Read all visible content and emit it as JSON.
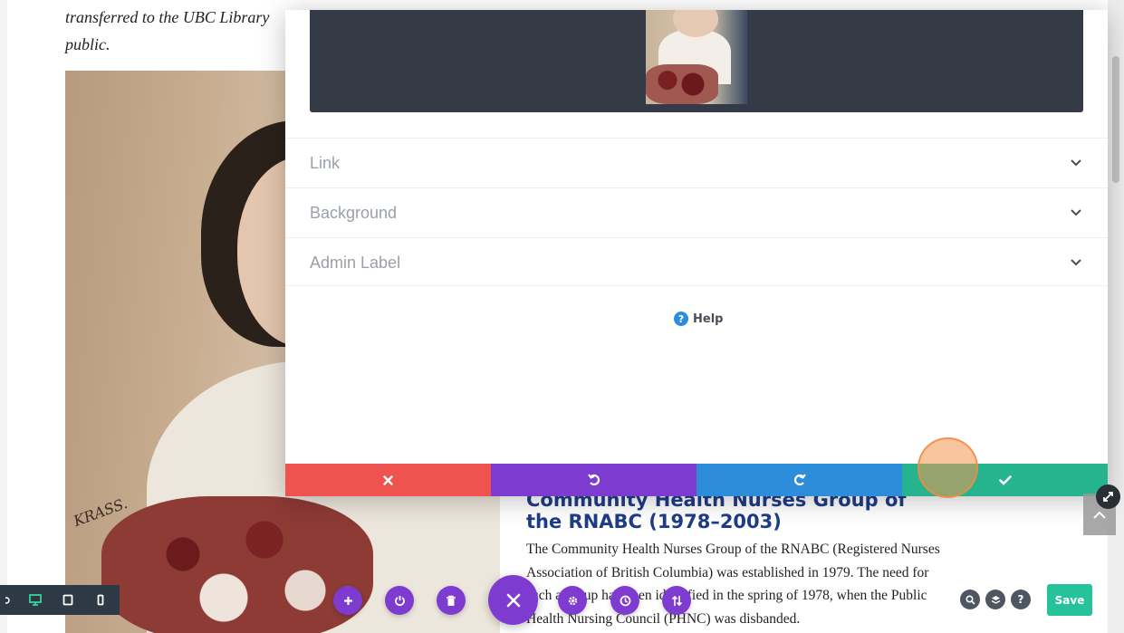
{
  "background_page": {
    "intro_text": "transferred to the UBC Library public.",
    "photo_signature": "KRASS.",
    "article_heading": "Community Health Nurses Group of the RNABC (1978–2003)",
    "article_body": "The Community Health Nurses Group of the RNABC (Registered Nurses Association of British Columbia) was established in 1979. The need for such a group had been identified in the spring of 1978, when the Public Health Nursing Council (PHNC) was disbanded."
  },
  "modal": {
    "sections": [
      {
        "label": "Link"
      },
      {
        "label": "Background"
      },
      {
        "label": "Admin Label"
      }
    ],
    "help_label": "Help",
    "help_icon_glyph": "?"
  },
  "builder": {
    "save_label": "Save",
    "help_glyph": "?"
  },
  "colors": {
    "cancel": "#ef5350",
    "undo": "#7e3bd0",
    "redo": "#2e8ddb",
    "confirm": "#26b48e",
    "save_button": "#26c39a",
    "fab": "#7e3bd0",
    "heading": "#1f3c88"
  }
}
